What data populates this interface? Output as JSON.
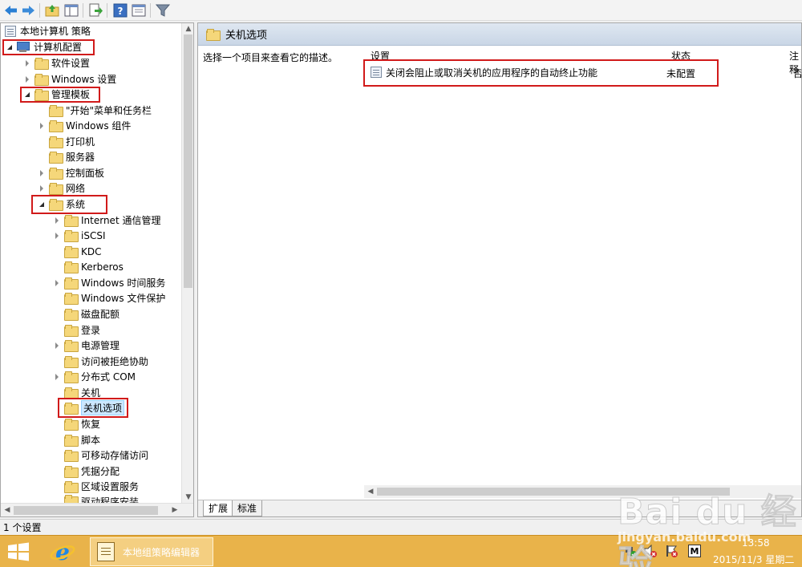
{
  "toolbar": {
    "icons": [
      "back-icon",
      "forward-icon",
      "up-folder-icon",
      "show-hide-tree-icon",
      "export-list-icon",
      "help-icon",
      "properties-icon",
      "filter-icon"
    ]
  },
  "tree": {
    "root": "本地计算机 策略",
    "computer_config": "计算机配置",
    "software_settings": "软件设置",
    "windows_settings": "Windows 设置",
    "admin_templates": "管理模板",
    "start_menu": "\"开始\"菜单和任务栏",
    "windows_components": "Windows 组件",
    "printers": "打印机",
    "server": "服务器",
    "control_panel": "控制面板",
    "network": "网络",
    "system": "系统",
    "system_children": [
      "Internet 通信管理",
      "iSCSI",
      "KDC",
      "Kerberos",
      "Windows 时间服务",
      "Windows 文件保护",
      "磁盘配额",
      "登录",
      "电源管理",
      "访问被拒绝协助",
      "分布式 COM",
      "关机",
      "关机选项",
      "恢复",
      "脚本",
      "可移动存储访问",
      "凭据分配",
      "区域设置服务",
      "驱动程序安装"
    ]
  },
  "right_pane": {
    "header_title": "关机选项",
    "description_prompt": "选择一个项目来查看它的描述。",
    "columns": {
      "setting": "设置",
      "state": "状态",
      "comment": "注释"
    },
    "rows": [
      {
        "setting": "关闭会阻止或取消关机的应用程序的自动终止功能",
        "state": "未配置",
        "comment": "否"
      }
    ],
    "tabs": [
      "扩展",
      "标准"
    ]
  },
  "status_bar": {
    "text": "1 个设置"
  },
  "taskbar": {
    "app_label": "本地组策略编辑器",
    "time": "13:58",
    "date": "2015/11/3 星期二",
    "m_label": "M"
  },
  "watermark": {
    "logo": "Bai du 经验",
    "url": "jingyan.baidu.com"
  },
  "colors": {
    "highlight_box": "#d11a1a",
    "taskbar": "#e9b34a",
    "selection": "#cce8ff"
  }
}
